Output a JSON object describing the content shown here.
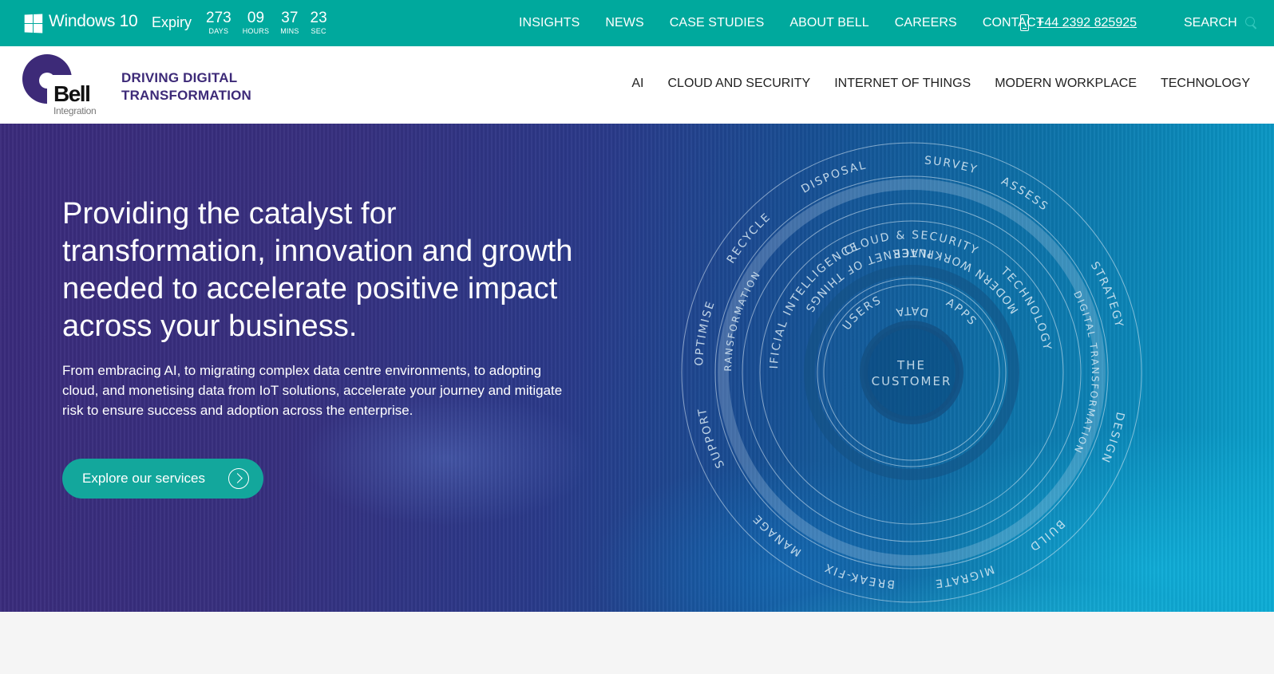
{
  "topbar": {
    "os_title": "Windows 10",
    "expiry_label": "Expiry",
    "countdown": [
      {
        "value": "273",
        "label": "DAYS"
      },
      {
        "value": "09",
        "label": "HOURS"
      },
      {
        "value": "37",
        "label": "MINS"
      },
      {
        "value": "23",
        "label": "SEC"
      }
    ],
    "nav": [
      "INSIGHTS",
      "NEWS",
      "CASE STUDIES",
      "ABOUT BELL",
      "CAREERS",
      "CONTACT"
    ],
    "phone": "+44 2392 825925",
    "search_label": "SEARCH",
    "bg_color": "#00a99d"
  },
  "header": {
    "logo_name": "Bell",
    "logo_sub": "Integration",
    "tagline_line1": "DRIVING DIGITAL",
    "tagline_line2": "TRANSFORMATION",
    "nav": [
      "AI",
      "CLOUD AND SECURITY",
      "INTERNET OF THINGS",
      "MODERN WORKPLACE",
      "TECHNOLOGY"
    ],
    "brand_color": "#3d2a78"
  },
  "hero": {
    "title": "Providing the catalyst for transformation, innovation and growth needed to accelerate positive impact across your business.",
    "text": "From embracing AI, to migrating complex data centre environments, to adopting cloud, and monetising data from IoT solutions, accelerate your journey and mitigate risk to ensure success and adoption across the enterprise.",
    "cta_label": "Explore our services",
    "cta_color": "#13a79c",
    "wheel": {
      "center": [
        "THE",
        "CUSTOMER"
      ],
      "inner": [
        "USERS",
        "APPS",
        "DATA"
      ],
      "middle": [
        "CLOUD & SECURITY",
        "TECHNOLOGY",
        "MODERN WORKPLACE",
        "INTERNET OF THINGS",
        "ARTIFICIAL INTELLIGENCE"
      ],
      "ring_label": "DIGITAL TRANSFORMATION",
      "outer": [
        "SURVEY",
        "ASSESS",
        "STRATEGY",
        "DESIGN",
        "BUILD",
        "MIGRATE",
        "BREAK-FIX",
        "MANAGE",
        "SUPPORT",
        "OPTIMISE",
        "RECYCLE",
        "DISPOSAL"
      ]
    }
  }
}
